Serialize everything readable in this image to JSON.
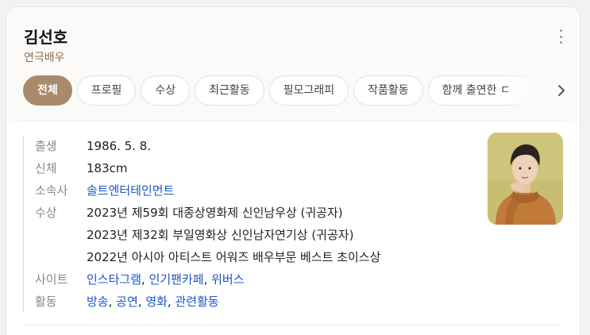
{
  "profile": {
    "name": "김선호",
    "occupation": "연극배우"
  },
  "tabs": [
    "전체",
    "프로필",
    "수상",
    "최근활동",
    "필모그래피",
    "작품활동",
    "함께 출연한 ㄷ"
  ],
  "info": {
    "birth": {
      "label": "출생",
      "value": "1986. 5. 8."
    },
    "height": {
      "label": "신체",
      "value": "183cm"
    },
    "agency": {
      "label": "소속사",
      "value": "솔트엔터테인먼트"
    },
    "awards": {
      "label": "수상",
      "lines": [
        "2023년 제59회 대종상영화제 신인남우상 (귀공자)",
        "2023년 제32회 부일영화상 신인남자연기상 (귀공자)",
        "2022년 아시아 아티스트 어워즈 배우부문 베스트 초이스상"
      ]
    },
    "sites": {
      "label": "사이트",
      "links": [
        "인스타그램",
        "인기팬카페",
        "위버스"
      ]
    },
    "activities": {
      "label": "활동",
      "links": [
        "방송",
        "공연",
        "영화",
        "관련활동"
      ]
    }
  },
  "colors": {
    "accent": "#a98a6b",
    "link": "#1a55c8",
    "subtitle": "#8c6f52"
  },
  "icons": {
    "more": "more-vertical-icon",
    "next": "chevron-right-icon"
  }
}
